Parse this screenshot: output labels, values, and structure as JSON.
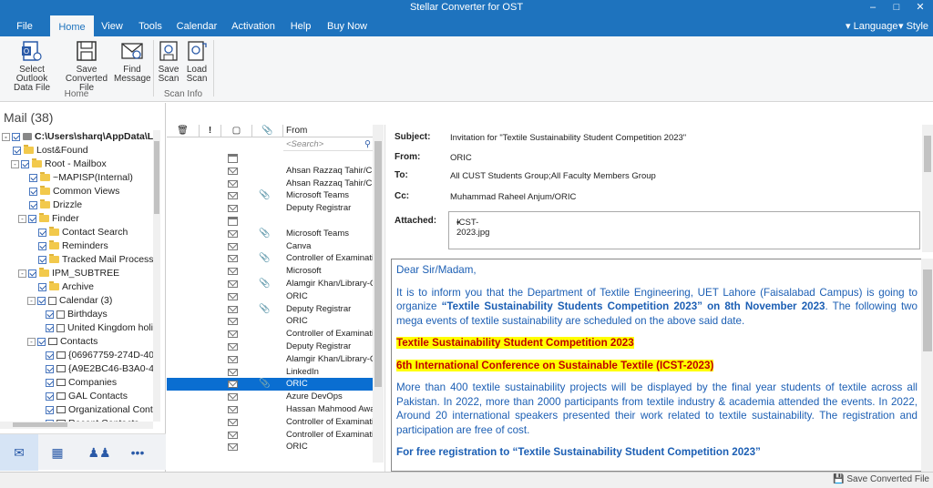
{
  "window": {
    "title": "Stellar Converter for OST"
  },
  "menu": {
    "items": [
      "File",
      "Home",
      "View",
      "Tools",
      "Calendar",
      "Activation",
      "Help",
      "Buy Now"
    ],
    "language": "Language",
    "style": "Style"
  },
  "ribbon": {
    "select_outlook_l1": "Select Outlook",
    "select_outlook_l2": "Data File",
    "save_converted_l1": "Save",
    "save_converted_l2": "Converted File",
    "find_message_l1": "Find",
    "find_message_l2": "Message",
    "home_group": "Home",
    "save_scan_l1": "Save",
    "save_scan_l2": "Scan",
    "load_scan_l1": "Load",
    "load_scan_l2": "Scan",
    "scan_info_group": "Scan Info"
  },
  "left": {
    "title": "Mail (38)",
    "tree": [
      "C:\\Users\\sharq\\AppData\\Loca",
      "Lost&Found",
      "Root - Mailbox",
      "~MAPISP(Internal)",
      "Common Views",
      "Drizzle",
      "Finder",
      "Contact Search",
      "Reminders",
      "Tracked Mail Processing",
      "IPM_SUBTREE",
      "Archive",
      "Calendar (3)",
      "Birthdays",
      "United Kingdom holid",
      "Contacts",
      "{06967759-274D-40B",
      "{A9E2BC46-B3A0-424",
      "Companies",
      "GAL Contacts",
      "Organizational Contac",
      "Recent Contacts"
    ]
  },
  "list": {
    "from_header": "From",
    "search_placeholder": "<Search>",
    "rows": [
      "",
      "Ahsan Razzaq Tahir/CUS",
      "Ahsan Razzaq Tahir/CUS",
      "Microsoft Teams",
      "Deputy Registrar",
      "",
      "Microsoft Teams",
      "Canva",
      "Controller of Examination",
      "Microsoft",
      "Alamgir Khan/Library-CUS",
      "ORIC",
      "Deputy Registrar",
      "ORIC",
      "Controller of Examination",
      "Deputy Registrar",
      "Alamgir Khan/Library-CUS",
      "LinkedIn",
      "ORIC",
      "Azure DevOps",
      "Hassan Mahmood Awan",
      "Controller of Examination",
      "Controller of Examination",
      "ORIC"
    ]
  },
  "reading": {
    "subject_label": "Subject:",
    "subject": "Invitation for \"Textile Sustainability Student Competition 2023\"",
    "from_label": "From:",
    "from": "ORIC",
    "to_label": "To:",
    "to": "All CUST Students Group;All Faculty Members Group",
    "cc_label": "Cc:",
    "cc": "Muhammad Raheel Anjum/ORIC",
    "attached_label": "Attached:",
    "attachment": "ICST-2023.jpg",
    "body": {
      "greeting": "Dear Sir/Madam,",
      "p1_a": "It is to inform you that the Department of Textile Engineering, UET Lahore (Faisalabad Campus) is going to organize ",
      "p1_b": "“Textile Sustainability Students Competition 2023” on 8th November 2023",
      "p1_c": ". The following two mega events of textile sustainability are scheduled on the above said date.",
      "event1": "Textile Sustainability Student Competition 2023",
      "event2": "6th International Conference on Sustainable Textile (ICST-2023)",
      "p2": "More than 400 textile sustainability projects will be displayed by the final year students of textile across all Pakistan. In 2022, more than 2000 participants from textile industry & academia attended the events. In 2022, Around 20 international speakers presented their work related to textile sustainability. The registration and participation are free of cost.",
      "p3": "For free registration to “Textile Sustainability Student Competition 2023”"
    }
  },
  "status": {
    "save_converted": "Save Converted File"
  },
  "colors": {
    "accent": "#1e73be",
    "selected_row": "#0a6ed1",
    "highlight": "#ffff00",
    "body_text": "#1c5fb4"
  }
}
